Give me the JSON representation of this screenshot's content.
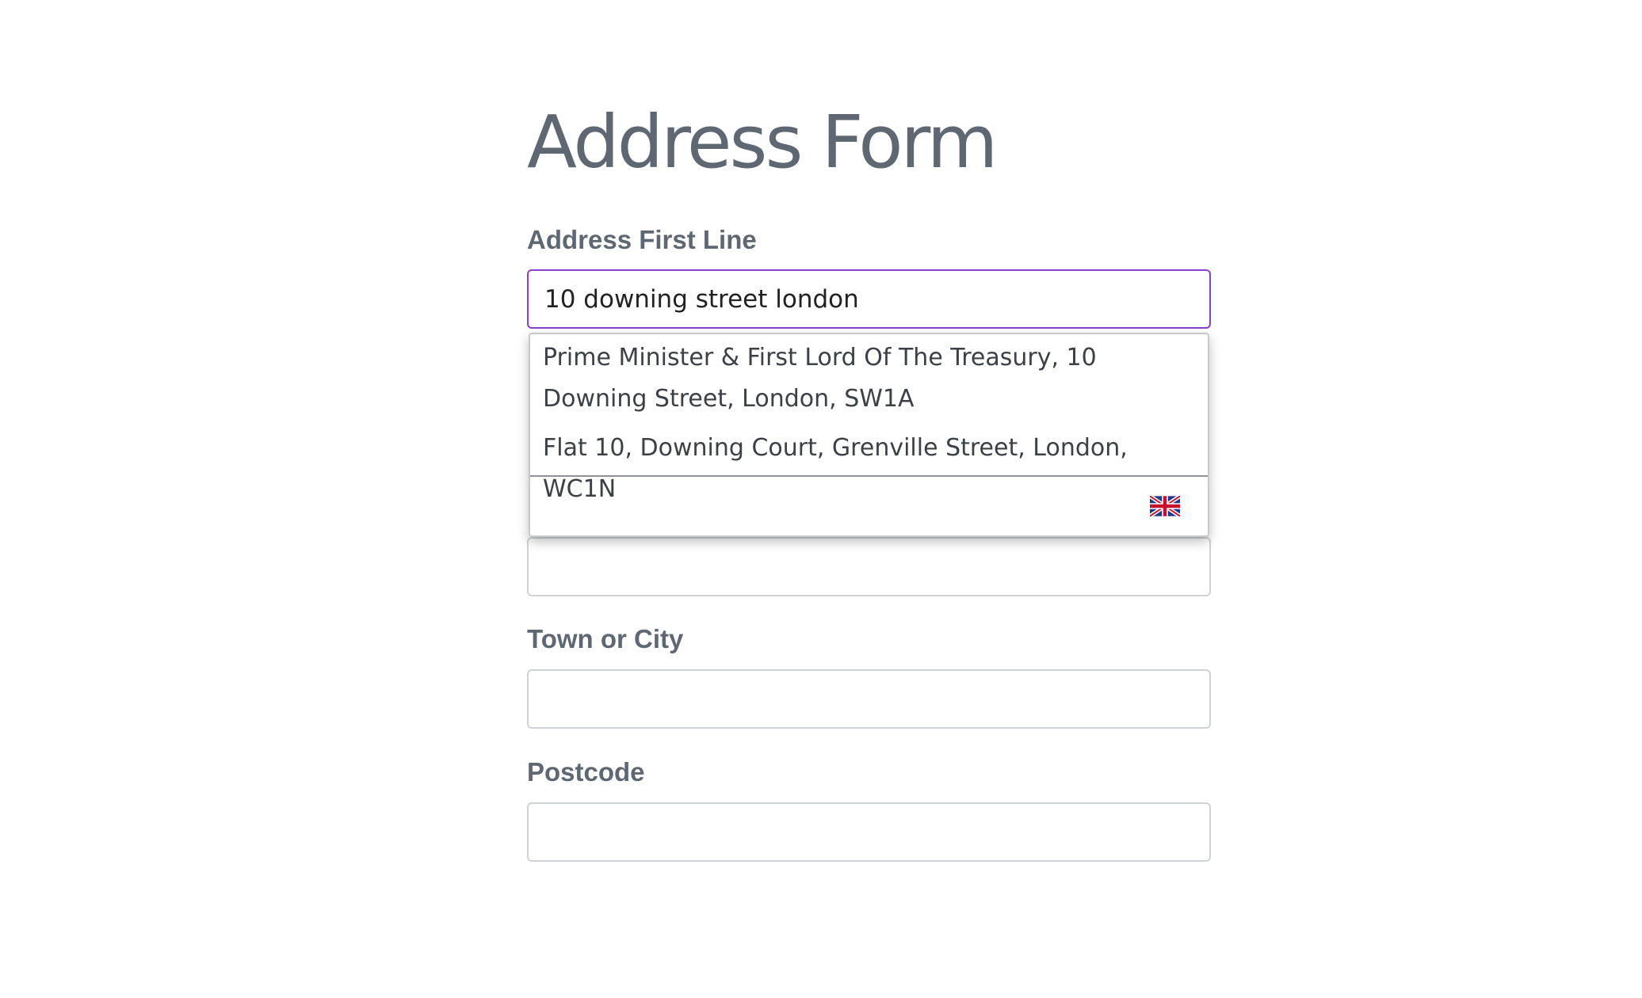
{
  "page": {
    "title": "Address Form"
  },
  "fields": {
    "address_first_line": {
      "label": "Address First Line",
      "value": "10 downing street london"
    },
    "address_second_line": {
      "value": ""
    },
    "town_or_city": {
      "label": "Town or City",
      "value": ""
    },
    "postcode": {
      "label": "Postcode",
      "value": ""
    }
  },
  "autocomplete": {
    "suggestions": [
      {
        "text": "Prime Minister & First Lord Of The Treasury, 10 Downing Street, London, SW1A"
      },
      {
        "text": "Flat 10, Downing Court, Grenville Street, London, WC1N"
      }
    ],
    "footer_icon": "uk-flag-icon"
  },
  "colors": {
    "focus_border": "#8a3fd1",
    "label_text": "#5f6872",
    "field_border": "#cfd2d6"
  }
}
